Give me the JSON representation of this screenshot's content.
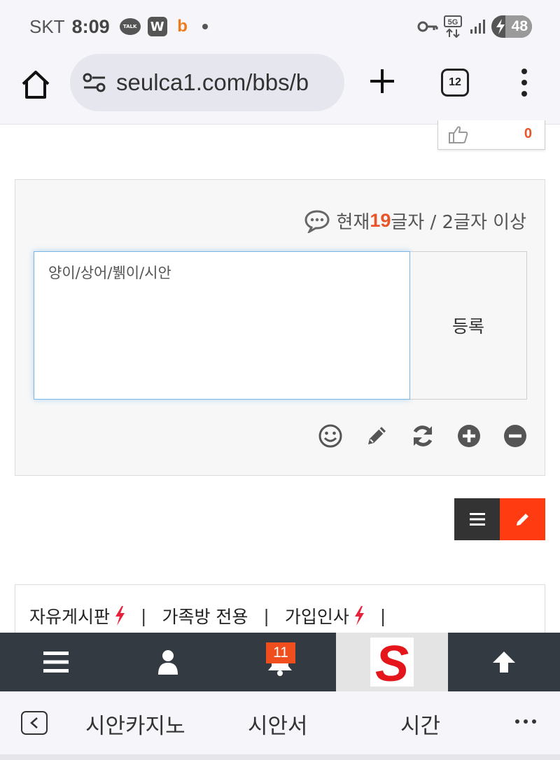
{
  "status_bar": {
    "carrier": "SKT",
    "time": "8:09",
    "talk_badge": "TALK",
    "w_badge": "W",
    "b_badge": "b",
    "network": "5G",
    "battery": "48",
    "battery_level": 0.48
  },
  "browser": {
    "url": "seulca1.com/bbs/b",
    "tab_count": "12"
  },
  "like": {
    "count": "0"
  },
  "comment": {
    "counter_prefix": "현재 ",
    "counter_value": "19",
    "counter_suffix": "글자 / 2글자 이상",
    "text": "양이/상어/뷁이/시안",
    "submit_label": "등록",
    "tools": [
      "smile-icon",
      "pencil-icon",
      "refresh-icon",
      "plus-circle-icon",
      "minus-circle-icon"
    ]
  },
  "links": [
    {
      "label": "자유게시판",
      "hot": true
    },
    {
      "label": "가족방 전용",
      "hot": false
    },
    {
      "label": "가입인사",
      "hot": true
    }
  ],
  "site_nav": {
    "notification_count": "11",
    "logo_letter": "S"
  },
  "bottom_bar": {
    "items": [
      "시안카지노",
      "시안서",
      "시간"
    ]
  },
  "colors": {
    "accent": "#e8552b",
    "write_button": "#ff3b12",
    "nav_bg": "#333a42",
    "hot_bolt": "#e8203a"
  }
}
